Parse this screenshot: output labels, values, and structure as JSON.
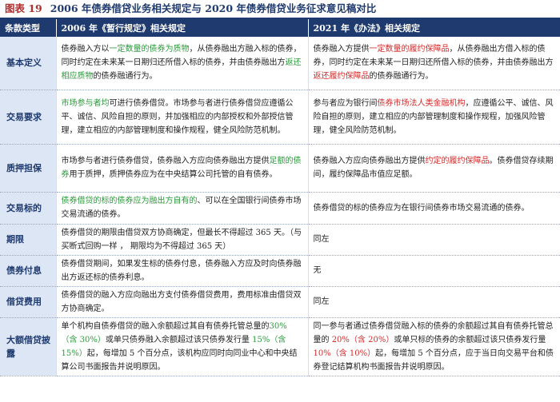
{
  "title": {
    "label": "图表 19",
    "text": "2006 年债券借贷业务相关规定与 2020 年债券借贷业务征求意见稿对比"
  },
  "columns": [
    "条款类型",
    "2006 年《暂行规定》相关规定",
    "2021 年《办法》相关规定"
  ],
  "rows": [
    {
      "category": "基本定义",
      "old": [
        {
          "t": "债券融入方以"
        },
        {
          "t": "一定数量的债券为质物",
          "c": "g"
        },
        {
          "t": "，从债券融出方融入标的债券，同时约定在未来某一日期归还所借入标的债券，并由债券融出方"
        },
        {
          "t": "返还相应质物",
          "c": "g"
        },
        {
          "t": "的债券融通行为。"
        }
      ],
      "new": [
        {
          "t": "债券融入方提供"
        },
        {
          "t": "一定数量的履约保障品",
          "c": "r"
        },
        {
          "t": "，从债券融出方借入标的债券，同时约定在未来某一日期归还所借入标的债券，并由债券融出方"
        },
        {
          "t": "返还履约保障品",
          "c": "r"
        },
        {
          "t": "的债券融通行为。"
        }
      ]
    },
    {
      "category": "交易要求",
      "old": [
        {
          "t": "市场参与者均",
          "c": "g"
        },
        {
          "t": "可进行债券借贷。市场参与者进行债券借贷应遵循公平、诚信、风险自担的原则，并加强相应的内部授权和外部授信管理，建立相应的内部管理制度和操作规程，健全风险防范机制。"
        }
      ],
      "new": [
        {
          "t": "参与者应为银行间"
        },
        {
          "t": "债券市场法人类金融机构",
          "c": "r"
        },
        {
          "t": "，应遵循公平、诚信、风险自担的原则，建立相应的内部管理制度和操作规程，加强风险管理，健全风险防范机制。"
        }
      ]
    },
    {
      "category": "质押担保",
      "old": [
        {
          "t": "市场参与者进行债券借贷，债券融入方应向债券融出方提供"
        },
        {
          "t": "足额的债券",
          "c": "g"
        },
        {
          "t": "用于质押，质押债券应为在中央结算公司托管的自有债券。"
        }
      ],
      "new": [
        {
          "t": "债券融入方应向债券融出方提供"
        },
        {
          "t": "约定的履约保障品",
          "c": "r"
        },
        {
          "t": "。债券借贷存续期间，履约保障品市值应足额。"
        }
      ]
    },
    {
      "category": "交易标的",
      "old": [
        {
          "t": "债券借贷的标的债券应为融出方自有的",
          "c": "g"
        },
        {
          "t": "、可以在全国银行间债券市场交易流通的债券。"
        }
      ],
      "new": [
        {
          "t": "债券借贷的标的债券应为在银行间债券市场交易流通的债券。"
        }
      ]
    },
    {
      "category": "期限",
      "old": [
        {
          "t": "债券借贷的期限由借贷双方协商确定，但最长不得超过 365 天。（与买断式回购一样 ， 期限均为不得超过 365 天）"
        }
      ],
      "new": [
        {
          "t": "同左"
        }
      ]
    },
    {
      "category": "债券付息",
      "old": [
        {
          "t": "债券借贷期间，如果发生标的债券付息，债券融入方应及时向债券融出方返还标的债券利息。"
        }
      ],
      "new": [
        {
          "t": "无"
        }
      ]
    },
    {
      "category": "借贷费用",
      "old": [
        {
          "t": "债券借贷的融入方应向融出方支付债券借贷费用，费用标准由借贷双方协商确定。"
        }
      ],
      "new": [
        {
          "t": "同左"
        }
      ]
    },
    {
      "category": "大额借贷披露",
      "old": [
        {
          "t": "单个机构自债券借贷的融入余额超过其自有债券托管总量的"
        },
        {
          "t": "30%（含 30%）",
          "c": "g"
        },
        {
          "t": "或单只债券融入余额超过该只债券发行量 "
        },
        {
          "t": "15%（含 15%）",
          "c": "g"
        },
        {
          "t": "起，每增加 5 个百分点，该机构应同时向同业中心和中央结算公司书面报告并说明原因。"
        }
      ],
      "new": [
        {
          "t": "同一参与者通过债券借贷融入标的债券的余额超过其自有债券托管总量的 "
        },
        {
          "t": "20%（含 20%）",
          "c": "r"
        },
        {
          "t": "或单只标的债券的余额超过该只债券发行量 "
        },
        {
          "t": "10%（含 10%）",
          "c": "r"
        },
        {
          "t": "起，每增加 5 个百分点，应于当日向交易平台和债券登记结算机构书面报告并说明原因。"
        }
      ]
    }
  ]
}
